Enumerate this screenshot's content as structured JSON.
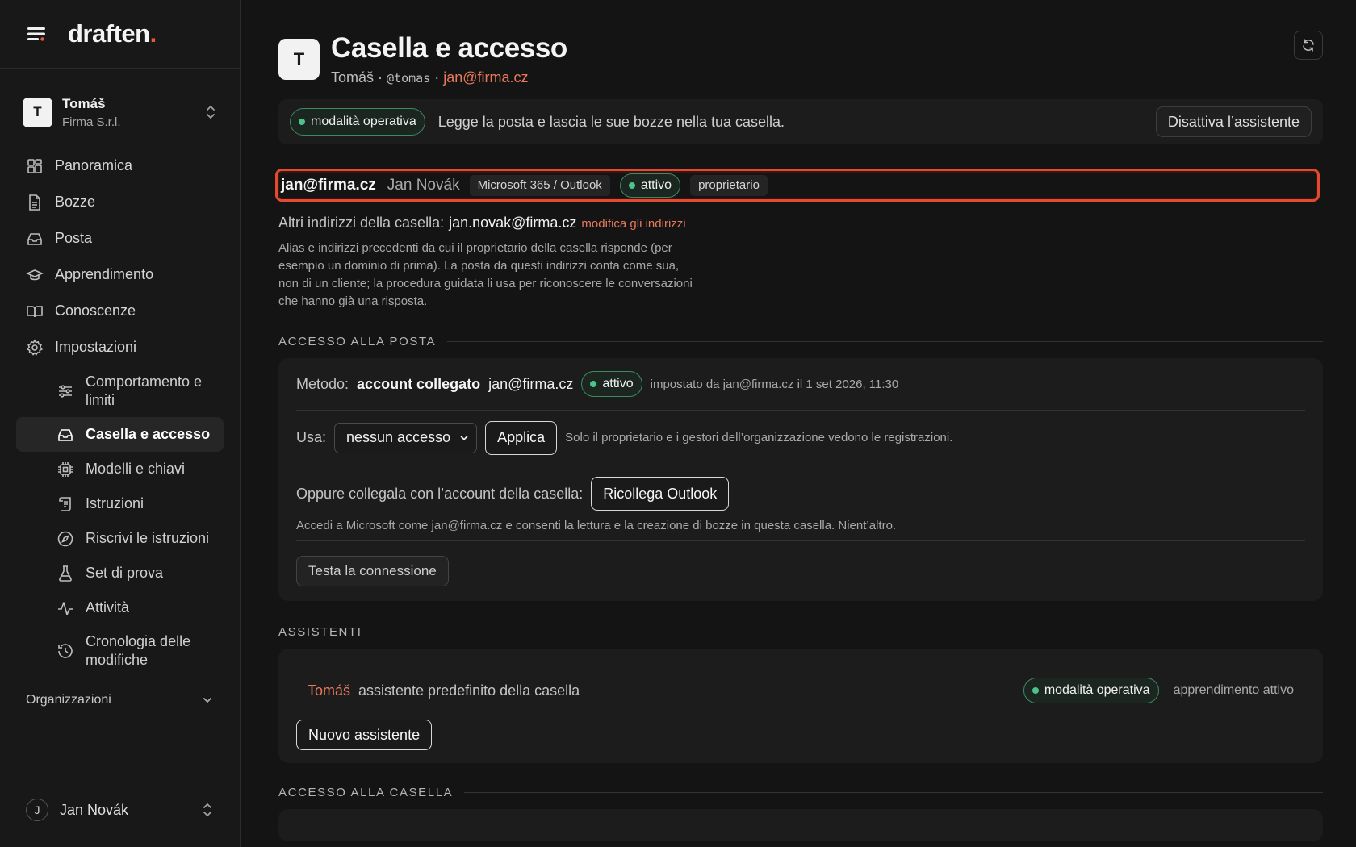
{
  "brand": {
    "name": "draften",
    "dot": "."
  },
  "workspace": {
    "initial": "T",
    "name": "Tomáš",
    "org": "Firma S.r.l."
  },
  "nav": {
    "overview": "Panoramica",
    "drafts": "Bozze",
    "mail": "Posta",
    "learning": "Apprendimento",
    "knowledge": "Conoscenze",
    "settings": "Impostazioni",
    "sub": {
      "behavior": "Comportamento e limiti",
      "mailbox": "Casella e accesso",
      "models": "Modelli e chiavi",
      "instructions": "Istruzioni",
      "rewrite": "Riscrivi le istruzioni",
      "testset": "Set di prova",
      "activity": "Attività",
      "history": "Cronologia delle modifiche"
    },
    "organizations": "Organizzazioni"
  },
  "user": {
    "initial": "J",
    "name": "Jan Novák"
  },
  "header": {
    "initial": "T",
    "title": "Casella e accesso",
    "sub_name": "Tomáš",
    "sep1": " · ",
    "handle": "@tomas",
    "sep2": " · ",
    "email": "jan@firma.cz"
  },
  "mode_bar": {
    "badge": "modalità operativa",
    "text": "Legge la posta e lascia le sue bozze nella tua casella.",
    "disable_button": "Disattiva l’assistente"
  },
  "mailbox": {
    "address": "jan@firma.cz",
    "owner": "Jan Novák",
    "provider": "Microsoft 365 / Outlook",
    "status": "attivo",
    "role": "proprietario"
  },
  "alt": {
    "label": "Altri indirizzi della casella:",
    "value": "jan.novak@firma.cz",
    "link": "modifica gli indirizzi",
    "help": "Alias e indirizzi precedenti da cui il proprietario della casella risponde (per esempio un dominio di prima). La posta da questi indirizzi conta come sua, non di un cliente; la procedura guidata li usa per riconoscere le conversazioni che hanno già una risposta."
  },
  "mail_access": {
    "heading": "ACCESSO ALLA POSTA",
    "method_label": "Metodo:",
    "method_value": "account collegato",
    "method_email": "jan@firma.cz",
    "status": "attivo",
    "set_by": "impostato da jan@firma.cz il 1 set 2026, 11:30",
    "use_label": "Usa:",
    "use_selected": "nessun accesso",
    "apply_button": "Applica",
    "use_note": "Solo il proprietario e i gestori dell’organizzazione vedono le registrazioni.",
    "reconnect_label": "Oppure collegala con l’account della casella:",
    "reconnect_button": "Ricollega Outlook",
    "reconnect_note": "Accedi a Microsoft come jan@firma.cz e consenti la lettura e la creazione di bozze in questa casella. Nient’altro.",
    "test_button": "Testa la connessione"
  },
  "assistants": {
    "heading": "ASSISTENTI",
    "name": "Tomáš",
    "desc": "assistente predefinito della casella",
    "mode": "modalità operativa",
    "learning": "apprendimento attivo",
    "new_button": "Nuovo assistente"
  },
  "mailbox_access": {
    "heading": "ACCESSO ALLA CASELLA"
  },
  "colors": {
    "accent": "#e8785c",
    "status_green": "#4cc489",
    "highlight": "#e24b31"
  }
}
